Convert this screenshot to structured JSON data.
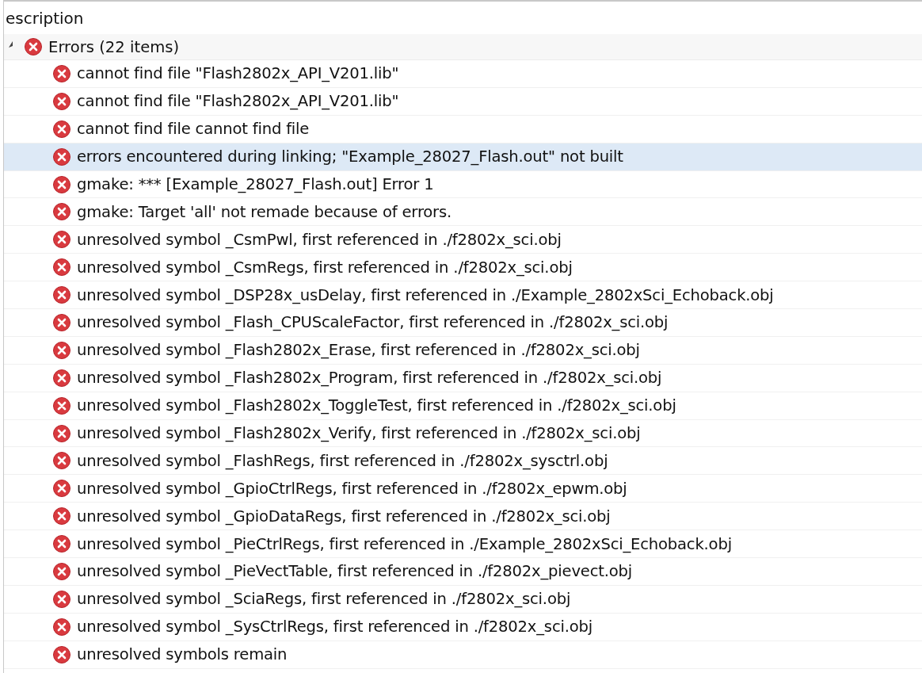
{
  "column_header": "escription",
  "group": {
    "label": "Errors (22 items)",
    "expanded": true,
    "children": [
      {
        "text": "cannot find file \"Flash2802x_API_V201.lib\"",
        "selected": false
      },
      {
        "text": "cannot find file \"Flash2802x_API_V201.lib\"",
        "selected": false
      },
      {
        "text": "cannot find file cannot find file",
        "selected": false
      },
      {
        "text": "errors encountered during linking; \"Example_28027_Flash.out\" not built",
        "selected": true
      },
      {
        "text": "gmake: *** [Example_28027_Flash.out] Error 1",
        "selected": false
      },
      {
        "text": "gmake: Target 'all' not remade because of errors.",
        "selected": false
      },
      {
        "text": "unresolved symbol _CsmPwl, first referenced in ./f2802x_sci.obj",
        "selected": false
      },
      {
        "text": "unresolved symbol _CsmRegs, first referenced in ./f2802x_sci.obj",
        "selected": false
      },
      {
        "text": "unresolved symbol _DSP28x_usDelay, first referenced in ./Example_2802xSci_Echoback.obj",
        "selected": false
      },
      {
        "text": "unresolved symbol _Flash_CPUScaleFactor, first referenced in ./f2802x_sci.obj",
        "selected": false
      },
      {
        "text": "unresolved symbol _Flash2802x_Erase, first referenced in ./f2802x_sci.obj",
        "selected": false
      },
      {
        "text": "unresolved symbol _Flash2802x_Program, first referenced in ./f2802x_sci.obj",
        "selected": false
      },
      {
        "text": "unresolved symbol _Flash2802x_ToggleTest, first referenced in ./f2802x_sci.obj",
        "selected": false
      },
      {
        "text": "unresolved symbol _Flash2802x_Verify, first referenced in ./f2802x_sci.obj",
        "selected": false
      },
      {
        "text": "unresolved symbol _FlashRegs, first referenced in ./f2802x_sysctrl.obj",
        "selected": false
      },
      {
        "text": "unresolved symbol _GpioCtrlRegs, first referenced in ./f2802x_epwm.obj",
        "selected": false
      },
      {
        "text": "unresolved symbol _GpioDataRegs, first referenced in ./f2802x_sci.obj",
        "selected": false
      },
      {
        "text": "unresolved symbol _PieCtrlRegs, first referenced in ./Example_2802xSci_Echoback.obj",
        "selected": false
      },
      {
        "text": "unresolved symbol _PieVectTable, first referenced in ./f2802x_pievect.obj",
        "selected": false
      },
      {
        "text": "unresolved symbol _SciaRegs, first referenced in ./f2802x_sci.obj",
        "selected": false
      },
      {
        "text": "unresolved symbol _SysCtrlRegs, first referenced in ./f2802x_sci.obj",
        "selected": false
      },
      {
        "text": "unresolved symbols remain",
        "selected": false
      }
    ]
  }
}
